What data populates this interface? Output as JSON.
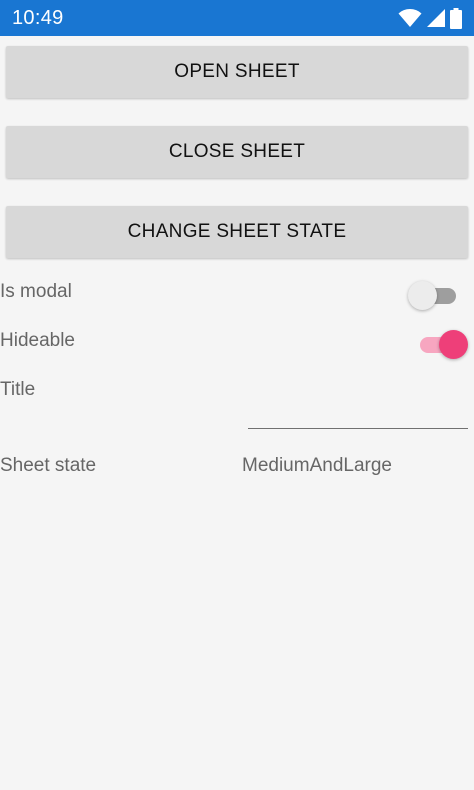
{
  "status_bar": {
    "time": "10:49",
    "icons": [
      "wifi-icon",
      "signal-icon",
      "battery-icon"
    ],
    "color": "#1976d2"
  },
  "buttons": {
    "open_sheet": "OPEN SHEET",
    "close_sheet": "CLOSE SHEET",
    "change_sheet_state": "CHANGE SHEET STATE"
  },
  "settings": {
    "is_modal": {
      "label": "Is modal",
      "checked": false
    },
    "hideable": {
      "label": "Hideable",
      "checked": true,
      "accent": "#ee3f79"
    },
    "title": {
      "label": "Title",
      "value": ""
    },
    "sheet_state": {
      "label": "Sheet state",
      "value": "MediumAndLarge"
    }
  }
}
